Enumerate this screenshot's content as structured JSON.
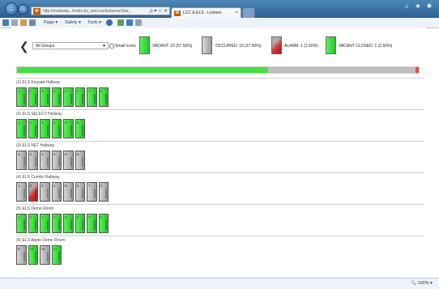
{
  "browser": {
    "back_glyph": "←",
    "forward_glyph": "→",
    "url": "http://modesta.../index.bs_web.iss/lockerse/Stat...",
    "addr_icon_glyph": "M",
    "addr_tools": "ρ ▾ ☆ ✕",
    "tab_title": "LCC & ELS - Lockers",
    "tab_icon_glyph": "M",
    "tab_close_glyph": "×",
    "cap_home_glyph": "⌂",
    "cap_fav_glyph": "★",
    "cap_gear_glyph": "✹",
    "commands": [
      "Page ▾",
      "Safety ▾",
      "Tools ▾"
    ],
    "zoom": "🔍 100%  ▾"
  },
  "toolbar": {
    "back_glyph": "❮",
    "group_select": "All Groups",
    "caret": "▼",
    "small_icons": "Small Icons"
  },
  "legend": [
    {
      "label": "VACANT: 23 (57.50%)",
      "kind": "vacant"
    },
    {
      "label": "OCCUPIED: 15 (37.50%)",
      "kind": "occupied"
    },
    {
      "label": "ALARM: 1 (2.50%)",
      "kind": "alarm"
    },
    {
      "label": "VACANT CLOSED: 1 (2.50%)",
      "kind": "vacant"
    }
  ],
  "status": {
    "vacant_fraction": 0.625
  },
  "groups": [
    {
      "title": "(1) ELS Keypad Hallway",
      "lockers": [
        {
          "n": "1",
          "s": "v"
        },
        {
          "n": "2",
          "s": "v"
        },
        {
          "n": "3",
          "s": "v"
        },
        {
          "n": "4",
          "s": "v"
        },
        {
          "n": "5",
          "s": "v"
        },
        {
          "n": "6",
          "s": "v"
        },
        {
          "n": "7",
          "s": "v"
        },
        {
          "n": "8",
          "s": "v"
        }
      ]
    },
    {
      "title": "(2) ELS SELECT Hallway",
      "lockers": [
        {
          "n": "1",
          "s": "v"
        },
        {
          "n": "2",
          "s": "v"
        },
        {
          "n": "3",
          "s": "v"
        },
        {
          "n": "4",
          "s": "v"
        },
        {
          "n": "5",
          "s": "v"
        },
        {
          "n": "6",
          "s": "v"
        }
      ]
    },
    {
      "title": "(3) ELS NET Hallway",
      "lockers": [
        {
          "n": "1",
          "s": "o"
        },
        {
          "n": "2",
          "s": "o"
        },
        {
          "n": "3",
          "s": "o"
        },
        {
          "n": "4",
          "s": "o"
        },
        {
          "n": "5",
          "s": "o"
        },
        {
          "n": "6",
          "s": "o"
        }
      ]
    },
    {
      "title": "(4) ELS Combo Hallway",
      "lockers": [
        {
          "n": "1",
          "s": "o"
        },
        {
          "n": "2",
          "s": "a"
        },
        {
          "n": "3",
          "s": "o"
        },
        {
          "n": "4",
          "s": "o"
        },
        {
          "n": "5",
          "s": "o"
        },
        {
          "n": "6",
          "s": "o"
        },
        {
          "n": "7",
          "s": "o"
        },
        {
          "n": "8",
          "s": "o"
        }
      ]
    },
    {
      "title": "(5) ELS Demo Room",
      "lockers": [
        {
          "n": "1",
          "s": "v"
        },
        {
          "n": "2",
          "s": "v"
        },
        {
          "n": "3",
          "s": "v"
        },
        {
          "n": "4",
          "s": "v"
        },
        {
          "n": "5",
          "s": "v"
        },
        {
          "n": "6",
          "s": "v"
        },
        {
          "n": "7",
          "s": "v"
        },
        {
          "n": "8",
          "s": "v"
        }
      ]
    },
    {
      "title": "(6) ELS Apple Demo Room",
      "lockers": [
        {
          "n": "9",
          "s": "o"
        },
        {
          "n": "10",
          "s": "v"
        },
        {
          "n": "11",
          "s": "o"
        },
        {
          "n": "12",
          "s": "v"
        }
      ]
    }
  ]
}
